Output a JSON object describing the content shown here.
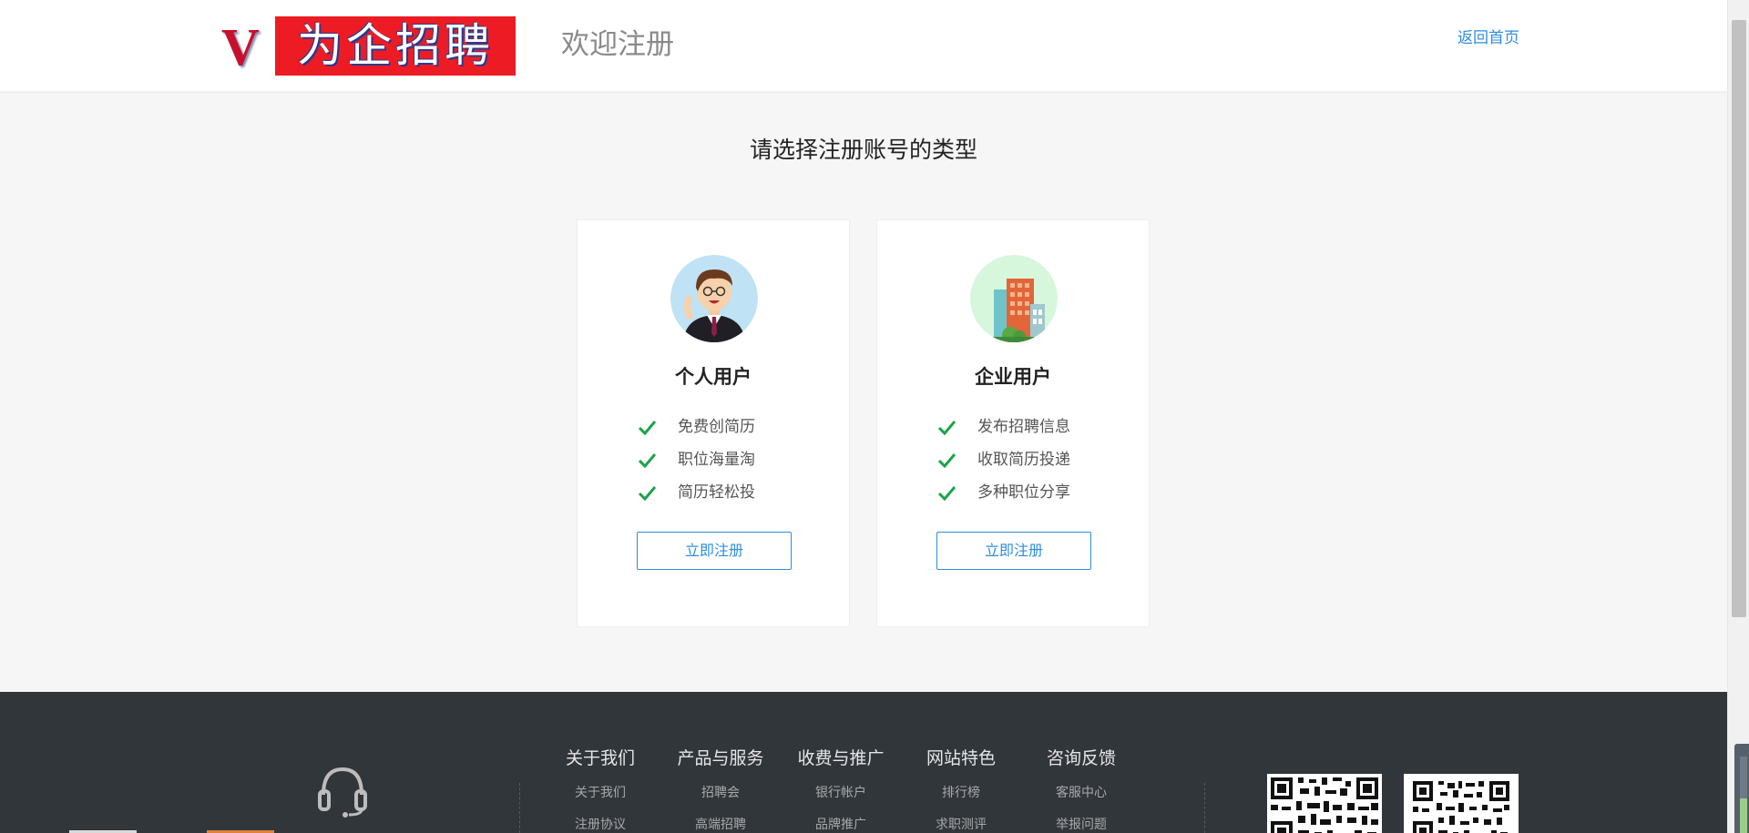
{
  "header": {
    "logo_letter": "V",
    "logo_text": "为企招聘",
    "welcome": "欢迎注册",
    "back_home": "返回首页"
  },
  "main": {
    "title": "请选择注册账号的类型"
  },
  "cards": [
    {
      "title": "个人用户",
      "features": [
        "免费创简历",
        "职位海量淘",
        "简历轻松投"
      ],
      "button": "立即注册"
    },
    {
      "title": "企业用户",
      "features": [
        "发布招聘信息",
        "收取简历投递",
        "多种职位分享"
      ],
      "button": "立即注册"
    }
  ],
  "footer": {
    "columns": [
      {
        "head": "关于我们",
        "item1": "关于我们",
        "item2": "注册协议"
      },
      {
        "head": "产品与服务",
        "item1": "招聘会",
        "item2": "高端招聘"
      },
      {
        "head": "收费与推广",
        "item1": "银行帐户",
        "item2": "品牌推广"
      },
      {
        "head": "网站特色",
        "item1": "排行榜",
        "item2": "求职测评"
      },
      {
        "head": "咨询反馈",
        "item1": "客服中心",
        "item2": "举报问题"
      }
    ]
  },
  "colors": {
    "accent": "#2f8de0",
    "check": "#1aa34a",
    "logo_red": "#ed1c24",
    "footer_bg": "#31363b",
    "page_bg": "#f6f6f6"
  },
  "icons": {
    "check": "check-icon",
    "headset": "headset-icon",
    "qr": "qr-code-icon"
  }
}
